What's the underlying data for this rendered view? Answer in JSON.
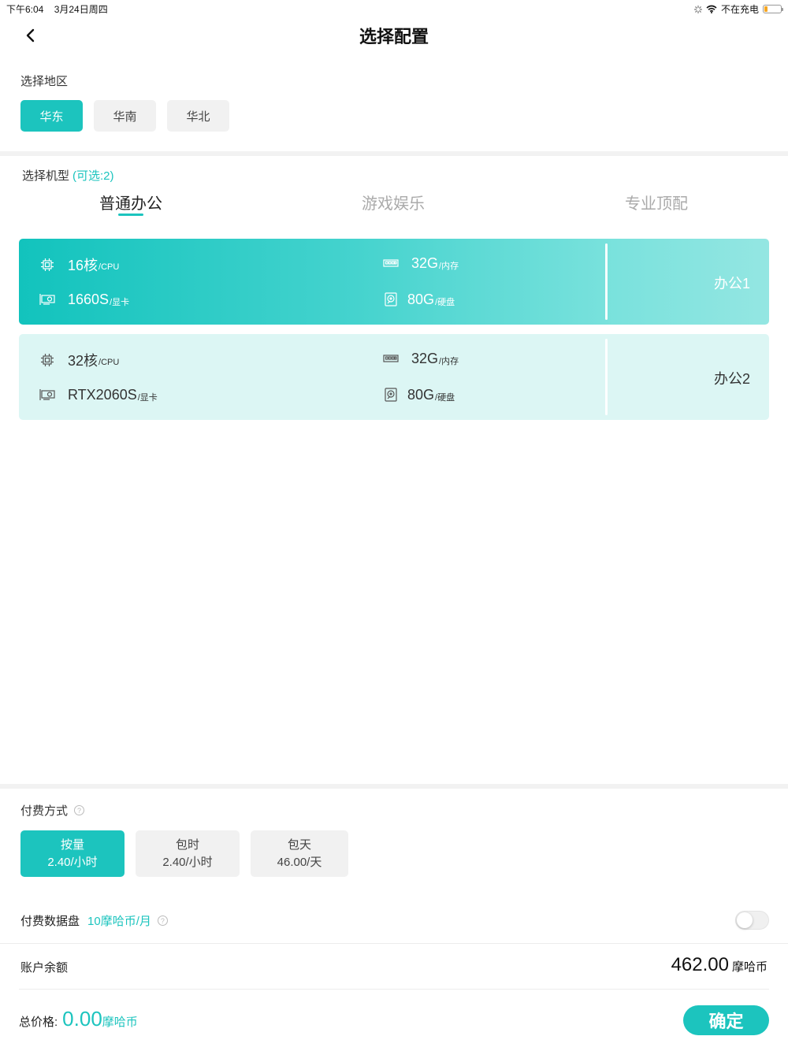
{
  "status_bar": {
    "time": "下午6:04",
    "date": "3月24日周四",
    "charging": "不在充电"
  },
  "nav": {
    "title": "选择配置"
  },
  "region": {
    "label": "选择地区",
    "options": [
      "华东",
      "华南",
      "华北"
    ],
    "selected": "华东"
  },
  "model": {
    "label": "选择机型",
    "available": "(可选:2)",
    "tabs": [
      "普通办公",
      "游戏娱乐",
      "专业顶配"
    ],
    "active_tab": "普通办公"
  },
  "configs": [
    {
      "name": "办公1",
      "cpu": "16核",
      "cpu_unit": "/CPU",
      "gpu": "1660S",
      "gpu_unit": "/显卡",
      "ram": "32G",
      "ram_unit": "/内存",
      "disk": "80G",
      "disk_unit": "/硬盘",
      "selected": true
    },
    {
      "name": "办公2",
      "cpu": "32核",
      "cpu_unit": "/CPU",
      "gpu": "RTX2060S",
      "gpu_unit": "/显卡",
      "ram": "32G",
      "ram_unit": "/内存",
      "disk": "80G",
      "disk_unit": "/硬盘",
      "selected": false
    }
  ],
  "payment": {
    "label": "付费方式",
    "options": [
      {
        "name": "按量",
        "price": "2.40/小时",
        "selected": true
      },
      {
        "name": "包时",
        "price": "2.40/小时",
        "selected": false
      },
      {
        "name": "包天",
        "price": "46.00/天",
        "selected": false
      }
    ]
  },
  "data_disk": {
    "label": "付费数据盘",
    "price": "10摩哈币/月",
    "enabled": false
  },
  "balance": {
    "label": "账户余额",
    "value": "462.00",
    "unit": "摩哈币"
  },
  "total": {
    "label": "总价格:",
    "value": "0.00",
    "unit": "摩哈币"
  },
  "confirm_label": "确定",
  "colors": {
    "accent": "#1cc4be",
    "chip_bg": "#f1f1f1",
    "card_unselected_bg": "#dcf6f4"
  },
  "icons": [
    "back-icon",
    "loading-icon",
    "wifi-icon",
    "battery-icon",
    "cpu-icon",
    "gpu-icon",
    "ram-icon",
    "disk-icon",
    "help-icon"
  ]
}
